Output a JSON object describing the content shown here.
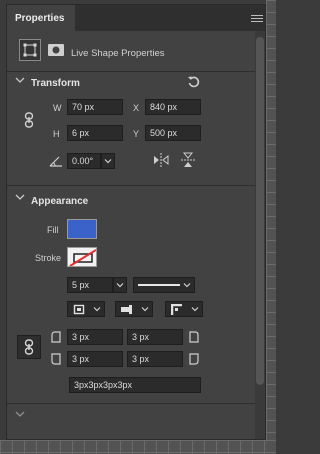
{
  "panel": {
    "tab_label": "Properties",
    "header_label": "Live Shape Properties"
  },
  "transform": {
    "title": "Transform",
    "w_label": "W",
    "w_value": "70 px",
    "h_label": "H",
    "h_value": "6 px",
    "x_label": "X",
    "x_value": "840 px",
    "y_label": "Y",
    "y_value": "500 px",
    "angle_value": "0.00°"
  },
  "appearance": {
    "title": "Appearance",
    "fill_label": "Fill",
    "fill_color": "#3a62c9",
    "stroke_label": "Stroke",
    "stroke_width": "5 px",
    "corner_tl": "3 px",
    "corner_tr": "3 px",
    "corner_bl": "3 px",
    "corner_br": "3 px",
    "corner_summary": "3px3px3px3px"
  },
  "icons": {
    "shape": "shape-bounds-icon",
    "mask": "mask-icon",
    "reset": "reset-icon",
    "link": "link-icon",
    "angle": "angle-icon",
    "flip_h": "flip-horizontal-icon",
    "flip_v": "flip-vertical-icon",
    "menu": "panel-menu-icon"
  }
}
